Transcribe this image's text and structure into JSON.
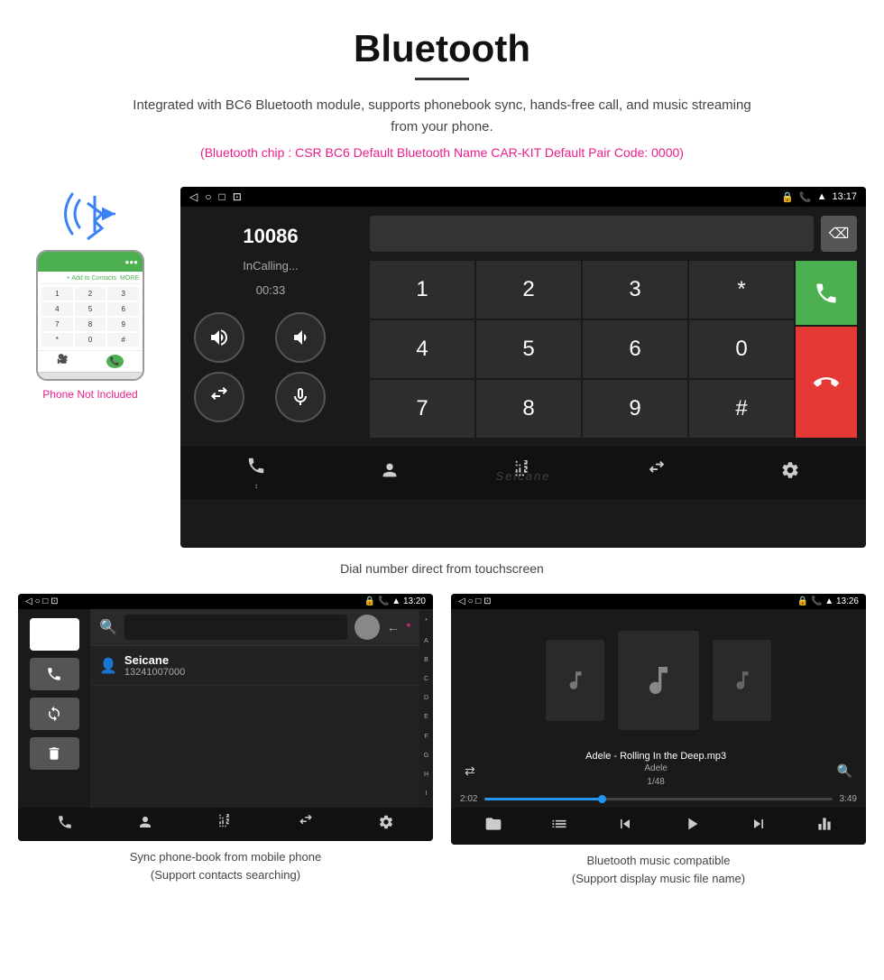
{
  "header": {
    "title": "Bluetooth",
    "description": "Integrated with BC6 Bluetooth module, supports phonebook sync, hands-free call, and music streaming from your phone.",
    "specs": "(Bluetooth chip : CSR BC6    Default Bluetooth Name CAR-KIT    Default Pair Code: 0000)"
  },
  "phone_label": "Phone Not Included",
  "car_screen_main": {
    "status_bar": {
      "nav_icons": "◁  ○  □  ⊡",
      "right_icons": "🔒 📞 ▲ 13:17"
    },
    "dialer_number": "10086",
    "calling_status": "InCalling...",
    "call_timer": "00:33",
    "keypad": {
      "keys": [
        "1",
        "2",
        "3",
        "*",
        "4",
        "5",
        "6",
        "0",
        "7",
        "8",
        "9",
        "#"
      ]
    },
    "green_btn_label": "📞",
    "red_btn_label": "📞"
  },
  "dial_caption": "Dial number direct from touchscreen",
  "phonebook_screen": {
    "contact_name": "Seicane",
    "contact_number": "13241007000",
    "time": "13:20",
    "alphabet": [
      "*",
      "A",
      "B",
      "C",
      "D",
      "E",
      "F",
      "G",
      "H",
      "I"
    ]
  },
  "music_screen": {
    "time": "13:26",
    "song_title": "Adele - Rolling In the Deep.mp3",
    "artist": "Adele",
    "track_info": "1/48",
    "time_current": "2:02",
    "time_total": "3:49",
    "progress_pct": 34
  },
  "captions": {
    "phonebook": "Sync phone-book from mobile phone\n(Support contacts searching)",
    "music": "Bluetooth music compatible\n(Support display music file name)"
  },
  "watermark": "Seicane"
}
